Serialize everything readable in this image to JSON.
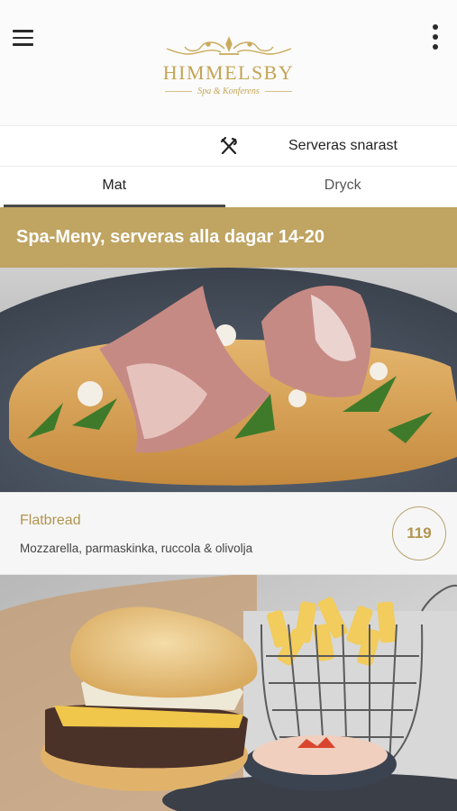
{
  "header": {
    "logo_title": "HIMMELSBY",
    "logo_subtitle": "Spa & Konferens"
  },
  "service": {
    "label": "Serveras snarast",
    "icon": "fork-knife-icon"
  },
  "tabs": [
    {
      "label": "Mat",
      "active": true
    },
    {
      "label": "Dryck",
      "active": false
    }
  ],
  "section": {
    "title": "Spa-Meny, serveras alla dagar 14-20"
  },
  "items": [
    {
      "name": "Flatbread",
      "description": "Mozzarella, parmaskinka, ruccola & olivolja",
      "price": "119"
    }
  ],
  "colors": {
    "gold": "#bfa462",
    "gold_text": "#b2954f"
  }
}
